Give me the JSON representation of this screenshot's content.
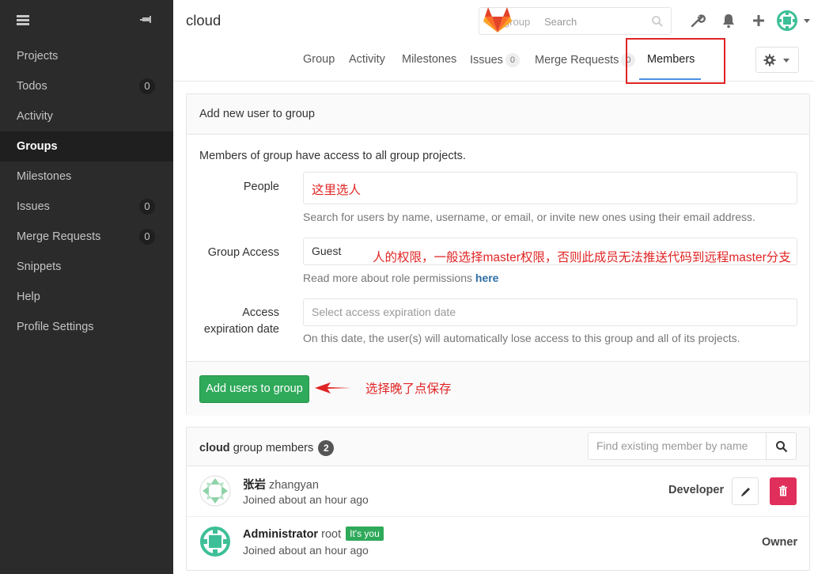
{
  "sidebar": {
    "items": [
      {
        "label": "Projects",
        "badge": ""
      },
      {
        "label": "Todos",
        "badge": "0"
      },
      {
        "label": "Activity",
        "badge": ""
      },
      {
        "label": "Groups",
        "badge": ""
      },
      {
        "label": "Milestones",
        "badge": ""
      },
      {
        "label": "Issues",
        "badge": "0"
      },
      {
        "label": "Merge Requests",
        "badge": "0"
      },
      {
        "label": "Snippets",
        "badge": ""
      },
      {
        "label": "Help",
        "badge": ""
      },
      {
        "label": "Profile Settings",
        "badge": ""
      }
    ],
    "active": "Groups"
  },
  "header": {
    "title": "cloud",
    "search_scope": "group",
    "search_placeholder": "Search"
  },
  "nav": {
    "tabs": [
      {
        "label": "Group"
      },
      {
        "label": "Activity"
      },
      {
        "label": "Milestones"
      },
      {
        "label": "Issues",
        "count": "0"
      },
      {
        "label": "Merge Requests",
        "count": "0"
      },
      {
        "label": "Members"
      }
    ],
    "active": "Members"
  },
  "add_panel": {
    "title": "Add new user to group",
    "intro": "Members of group have access to all group projects.",
    "people_label": "People",
    "people_value": "这里选人",
    "people_help": "Search for users by name, username, or email, or invite new ones using their email address.",
    "access_label": "Group Access",
    "access_value": "Guest",
    "access_annotation": "人的权限，一般选择master权限，否则此成员无法推送代码到远程master分支",
    "access_help_prefix": "Read more about role permissions ",
    "access_help_link": "here",
    "expiry_label_1": "Access",
    "expiry_label_2": "expiration date",
    "expiry_placeholder": "Select access expiration date",
    "expiry_help": "On this date, the user(s) will automatically lose access to this group and all of its projects.",
    "submit_label": "Add users to group",
    "submit_annotation": "选择晚了点保存"
  },
  "members_panel": {
    "group_name": "cloud",
    "title_suffix": " group members",
    "count": "2",
    "find_placeholder": "Find existing member by name",
    "members": [
      {
        "name": "张岩",
        "username": "zhangyan",
        "joined": "Joined about an hour ago",
        "role": "Developer",
        "you_badge": ""
      },
      {
        "name": "Administrator",
        "username": "root",
        "joined": "Joined about an hour ago",
        "role": "Owner",
        "you_badge": "It's you"
      }
    ]
  },
  "colors": {
    "sidebar_bg": "#2b2b2b",
    "primary_green": "#2fa95a",
    "danger": "#e02f5a",
    "annotation_red": "#e02424",
    "link_blue": "#2e6da4"
  }
}
